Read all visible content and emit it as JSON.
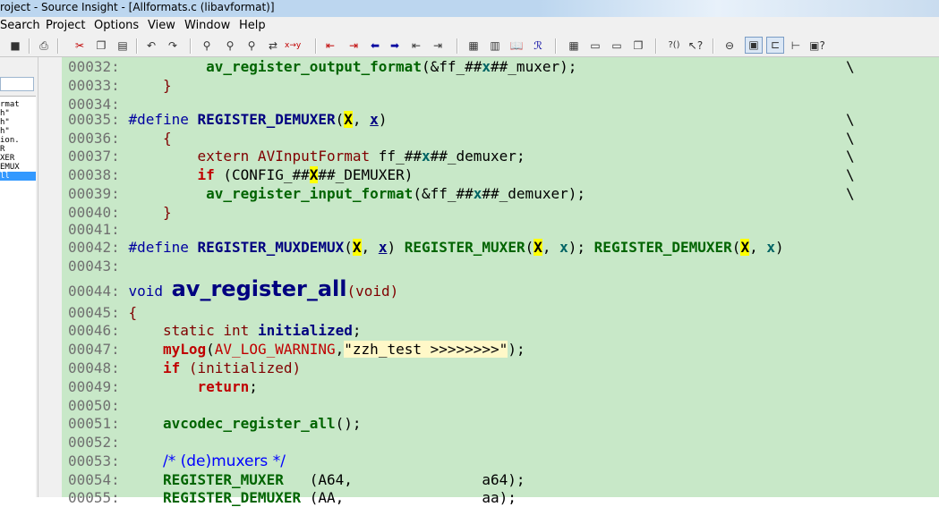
{
  "window": {
    "title": "roject - Source Insight - [Allformats.c (libavformat)]"
  },
  "menu": [
    "Search",
    "Project",
    "Options",
    "View",
    "Window",
    "Help"
  ],
  "toolbar_icons": [
    "save-icon",
    "print-icon",
    "cut-icon",
    "copy-icon",
    "paste-icon",
    "undo-icon",
    "redo-icon",
    "search-icon",
    "search-backward-icon",
    "search-forward-icon",
    "replace-icon",
    "bookmark-prev-icon",
    "bookmark-next-icon",
    "back-icon",
    "forward-icon",
    "jump-icon",
    "jump-def-icon",
    "browse-project-icon",
    "browse-file-icon",
    "lookup-icon",
    "reference-icon",
    "layout-icon",
    "window-icon",
    "panel-icon",
    "tile-icon",
    "symbol-info-icon",
    "context-help-icon",
    "toggle-icon",
    "context-window-icon",
    "relation-window-icon",
    "outline-icon",
    "help-book-icon"
  ],
  "sidebar": {
    "rows": [
      "rmat",
      "h\"",
      "h\"",
      "h\"",
      "ion.",
      "R",
      "XER",
      "EMUX",
      "ll"
    ],
    "selected_index": 8
  },
  "code": {
    "l32": {
      "ln": "00032:",
      "fn": "av_register_output_format",
      "a": "(&ff_##",
      "x": "x",
      "b": "##_muxer);",
      "bs": "\\"
    },
    "l33": {
      "ln": "00033:",
      "t": "}"
    },
    "l34": {
      "ln": "00034:"
    },
    "l35": {
      "ln": "00035:",
      "d": "#define ",
      "m": "REGISTER_DEMUXER",
      "p1": "(",
      "X": "X",
      "p2": ", ",
      "x": "x",
      "p3": ")",
      "bs": "\\"
    },
    "l36": {
      "ln": "00036:",
      "t": "{",
      "bs": "\\"
    },
    "l37": {
      "ln": "00037:",
      "e": "extern AVInputFormat ",
      "a": "ff_##",
      "x": "x",
      "b": "##_demuxer;",
      "bs": "\\"
    },
    "l38": {
      "ln": "00038:",
      "k": "if",
      "a": " (CONFIG_##",
      "X": "X",
      "b": "##_DEMUXER)",
      "bs": "\\"
    },
    "l39": {
      "ln": "00039:",
      "fn": "av_register_input_format",
      "a": "(&ff_##",
      "x": "x",
      "b": "##_demuxer);",
      "bs": "\\"
    },
    "l40": {
      "ln": "00040:",
      "t": "}"
    },
    "l41": {
      "ln": "00041:"
    },
    "l42": {
      "ln": "00042:",
      "d": "#define ",
      "m": "REGISTER_MUXDEMUX",
      "p1": "(",
      "X": "X",
      "p2": ", ",
      "x": "x",
      "p3": ") ",
      "m2": "REGISTER_MUXER",
      "q1": "(",
      "X2": "X",
      "q2": ", ",
      "x2": "x",
      "q3": "); ",
      "m3": "REGISTER_DEMUXER",
      "r1": "(",
      "X3": "X",
      "r2": ", ",
      "x3": "x",
      "r3": ")"
    },
    "l43": {
      "ln": "00043:"
    },
    "l44": {
      "ln": "00044:",
      "v": "void ",
      "fn": "av_register_all",
      "a": "(void)"
    },
    "l45": {
      "ln": "00045:",
      "t": "{"
    },
    "l46": {
      "ln": "00046:",
      "s": "static int ",
      "id": "initialized",
      "e": ";"
    },
    "l47": {
      "ln": "00047:",
      "fn": "myLog",
      "a": "(",
      "c": "AV_LOG_WARNING",
      "b": ",",
      "str": "\"zzh_test >>>>>>>>\"",
      "e": ");"
    },
    "l48": {
      "ln": "00048:",
      "k": "if",
      "a": " (initialized)"
    },
    "l49": {
      "ln": "00049:",
      "k": "return",
      "e": ";"
    },
    "l50": {
      "ln": "00050:"
    },
    "l51": {
      "ln": "00051:",
      "fn": "avcodec_register_all",
      "e": "();"
    },
    "l52": {
      "ln": "00052:"
    },
    "l53": {
      "ln": "00053:",
      "cmt": "/* (de)muxers */"
    },
    "l54": {
      "ln": "00054:",
      "fn": "REGISTER_MUXER",
      "a": "   (A64,               a64);"
    },
    "l55": {
      "ln": "00055:",
      "fn": "REGISTER_DEMUXER",
      "a": " (AA,                aa);"
    }
  },
  "colors": {
    "editor_bg": "#c8e8c8",
    "highlight": "#ffff00",
    "selection": "#3399ff"
  }
}
